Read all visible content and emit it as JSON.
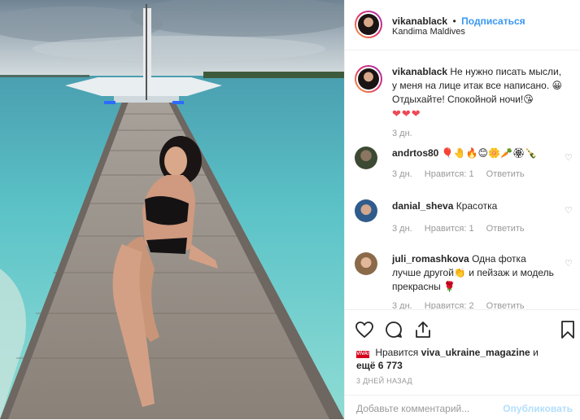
{
  "post": {
    "username": "vikanablack",
    "separator": "•",
    "follow_label": "Подписаться",
    "location": "Kandima Maldives"
  },
  "caption": {
    "username": "vikanablack",
    "text": "Не нужно писать мысли, у меня на лице итак все написано. 😀 Отдыхайте! Спокойной ночи!😘",
    "hearts": "❤❤❤",
    "time": "3 дн."
  },
  "comments": [
    {
      "username": "andrtos80",
      "text": "🎈🤚🔥😊🌼🥕🏵🍾",
      "time": "3 дн.",
      "likes": "Нравится: 1",
      "reply": "Ответить"
    },
    {
      "username": "danial_sheva",
      "text": "Красотка",
      "time": "3 дн.",
      "likes": "Нравится: 1",
      "reply": "Ответить"
    },
    {
      "username": "juli_romashkova",
      "text": "Одна фотка лучше другой👏 и пейзаж и модель прекрасны 🌹",
      "time": "3 дн.",
      "likes": "Нравится: 2",
      "reply": "Ответить"
    }
  ],
  "likes": {
    "badge": "VIVA!",
    "prefix": "Нравится",
    "liker": "viva_ukraine_magazine",
    "conj": "и",
    "others": "ещё 6 773"
  },
  "date": "3 ДНЕЙ НАЗАД",
  "add_comment": {
    "placeholder": "Добавьте комментарий...",
    "publish_label": "Опубликовать"
  },
  "icons": [
    "heart-icon",
    "comment-icon",
    "share-icon",
    "bookmark-icon"
  ]
}
